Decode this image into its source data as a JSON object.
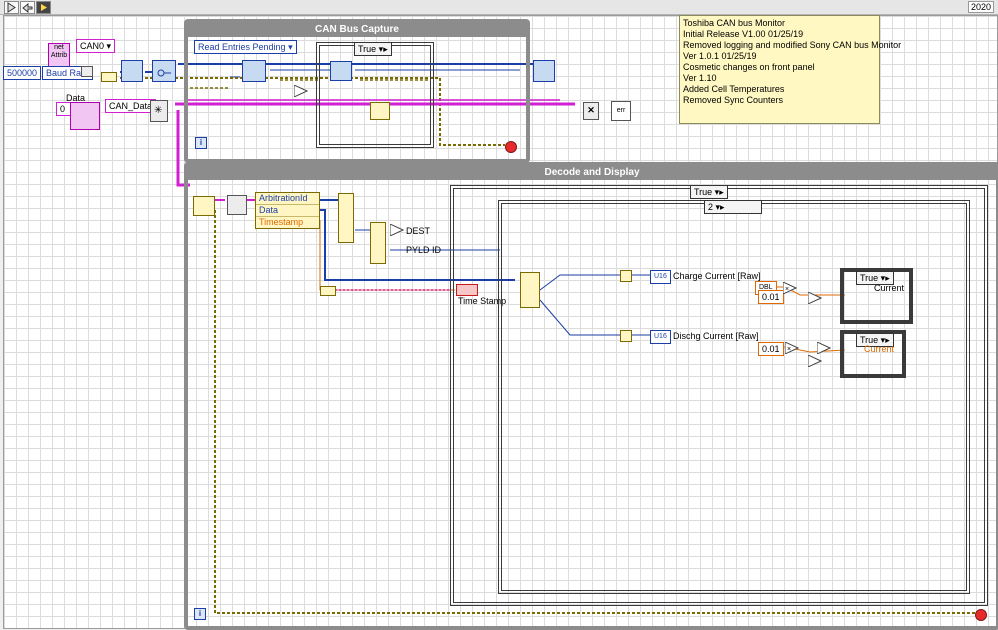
{
  "toolbar": {
    "version": "2020",
    "icons": [
      "run-arrow-icon",
      "run-continuously-icon"
    ]
  },
  "structures": {
    "can_bus_capture": {
      "title": "CAN Bus Capture",
      "case_selector": "True"
    },
    "decode_and_display": {
      "title": "Decode and Display",
      "outer_case_selector": "True",
      "inner_case_selector": "2",
      "charge_case_selector": "True",
      "dischg_case_selector": "True"
    }
  },
  "controls": {
    "baud_rate_value": "500000",
    "baud_rate_label": "Baud Rate",
    "can_port": "CAN0",
    "data_label": "Data",
    "data_index": "0",
    "can_data": "CAN_Data",
    "read_entries": "Read Entries Pending",
    "net_attr": "net Attrib",
    "dest": "DEST",
    "pyld_id": "PYLD ID",
    "time_stamp": "Time Stamp",
    "charge_current_raw": "Charge Current [Raw]",
    "dischg_current_raw": "Dischg Current [Raw]",
    "charge_current": "Current",
    "dischg_current": "Current",
    "scale_charge": "0.01",
    "scale_dischg": "0.01",
    "u16_label": "U16",
    "dbl_label": "DBL"
  },
  "cluster_fields": [
    "ArbitrationId",
    "Data",
    "Timestamp"
  ],
  "notes": [
    "Toshiba CAN bus Monitor",
    "Initial Release V1.00 01/25/19",
    "Removed logging and modified Sony CAN bus Monitor",
    "",
    "Ver 1.0.1 01/25/19",
    "Cosmetic changes on front panel",
    "",
    "Ver 1.10",
    "Added Cell Temperatures",
    "Removed Sync Counters"
  ],
  "colors": {
    "wire_blue": "#1b3fa6",
    "wire_pink": "#d11fd1",
    "wire_orange": "#e06a00",
    "wire_olive": "#7a6a00",
    "structure_gray": "#8c8c8c"
  }
}
